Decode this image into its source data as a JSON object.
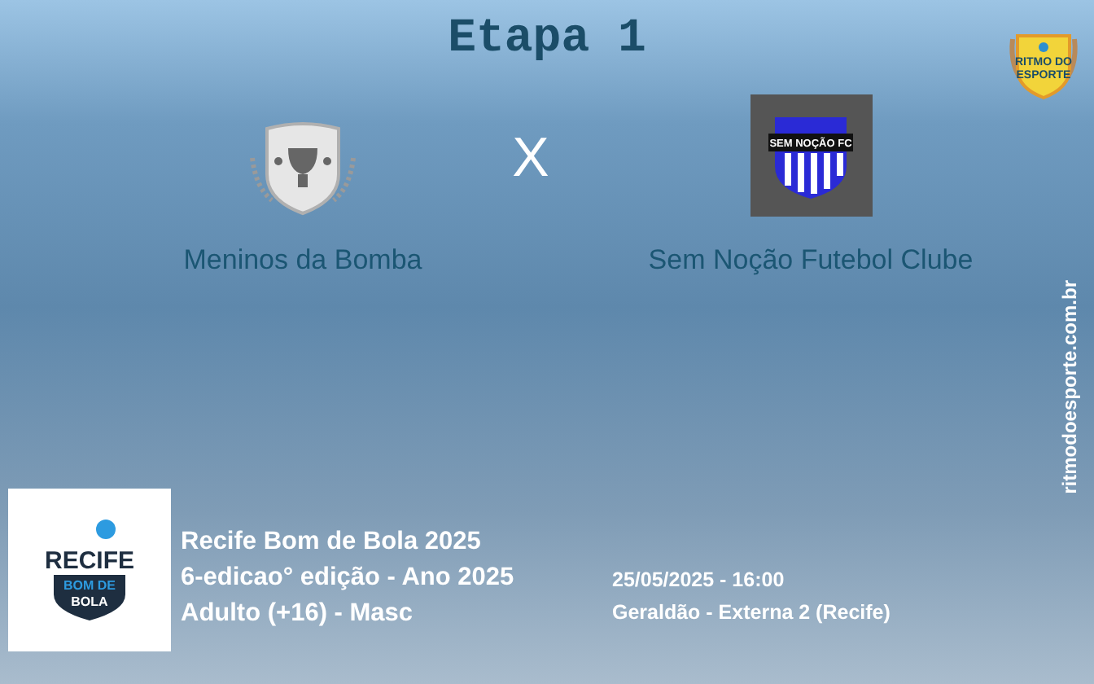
{
  "title": "Etapa 1",
  "site_logo": {
    "lines": [
      "RITMO DO",
      "ESPORTE"
    ]
  },
  "site_url": "ritmodoesporte.com.br",
  "match": {
    "separator": "X",
    "teams": [
      {
        "name": "Meninos da Bomba",
        "kind": "default"
      },
      {
        "name": "Sem Noção Futebol Clube",
        "kind": "crest",
        "crest_text": "SEM NOÇÃO FC"
      }
    ]
  },
  "competition": {
    "logo_lines": [
      "RECIFE",
      "BOM DE",
      "BOLA"
    ],
    "lines": [
      "Recife Bom de Bola 2025",
      "6-edicao° edição - Ano 2025",
      "Adulto (+16) - Masc"
    ]
  },
  "schedule": {
    "datetime": "25/05/2025 - 16:00",
    "venue": "Geraldão - Externa 2 (Recife)"
  }
}
